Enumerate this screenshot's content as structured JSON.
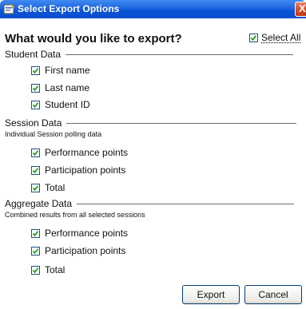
{
  "window": {
    "title": "Select Export Options",
    "close_glyph": "X"
  },
  "header": {
    "question": "What would you like to export?",
    "select_all_label": "Select All",
    "select_all_checked": true
  },
  "sections": [
    {
      "title": "Student Data",
      "subtitle": "",
      "options": [
        {
          "label": "First name",
          "checked": true
        },
        {
          "label": "Last name",
          "checked": true
        },
        {
          "label": "Student ID",
          "checked": true
        }
      ]
    },
    {
      "title": "Session Data",
      "subtitle": "Individual Session polling data",
      "options": [
        {
          "label": "Performance points",
          "checked": true
        },
        {
          "label": "Participation points",
          "checked": true
        },
        {
          "label": "Total",
          "checked": true
        }
      ]
    },
    {
      "title": "Aggregate Data",
      "subtitle": "Combined results from all selected sessions",
      "options": [
        {
          "label": "Performance points",
          "checked": true
        },
        {
          "label": "Participation points",
          "checked": true
        },
        {
          "label": "Total",
          "checked": true
        }
      ]
    }
  ],
  "buttons": {
    "export_label": "Export",
    "cancel_label": "Cancel"
  },
  "colors": {
    "titlebar": "#0a53d6",
    "close_button": "#d24726",
    "button_border": "#003c74"
  }
}
